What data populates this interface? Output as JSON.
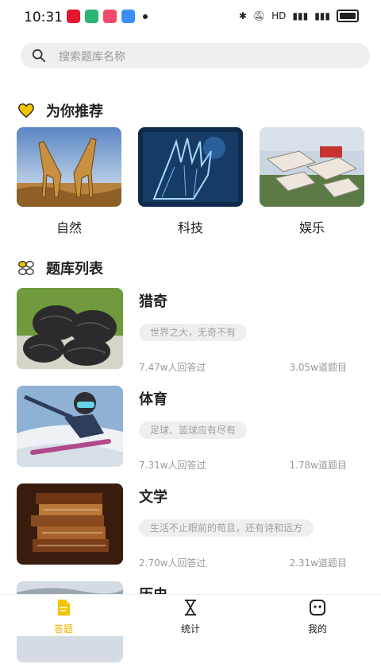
{
  "status": {
    "time": "10:31",
    "network": "HD"
  },
  "search": {
    "placeholder": "搜索题库名称"
  },
  "recommend": {
    "title": "为你推荐",
    "items": [
      {
        "label": "自然"
      },
      {
        "label": "科技"
      },
      {
        "label": "娱乐"
      }
    ]
  },
  "list": {
    "title": "题库列表",
    "items": [
      {
        "title": "猎奇",
        "tag": "世界之大，无奇不有",
        "users": "7.47w人回答过",
        "count": "3.05w道题目"
      },
      {
        "title": "体育",
        "tag": "足球、篮球应有尽有",
        "users": "7.31w人回答过",
        "count": "1.78w道题目"
      },
      {
        "title": "文学",
        "tag": "生活不止眼前的苟且，还有诗和远方",
        "users": "2.70w人回答过",
        "count": "2.31w道题目"
      },
      {
        "title": "历史"
      }
    ]
  },
  "tabbar": {
    "items": [
      {
        "label": "答题",
        "active": true
      },
      {
        "label": "统计"
      },
      {
        "label": "我的"
      }
    ]
  },
  "colors": {
    "accent": "#f5c400",
    "tag_bg": "#efefef"
  }
}
